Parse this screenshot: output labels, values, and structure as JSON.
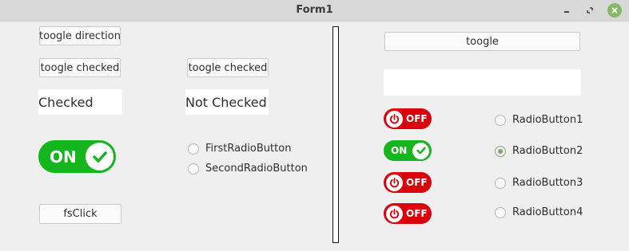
{
  "window": {
    "title": "Form1"
  },
  "left": {
    "toggle_direction_label": "toogle direction",
    "toggle_checked_label_1": "toogle checked",
    "toggle_checked_label_2": "toogle checked",
    "state_label_1": "Checked",
    "state_label_2": "Not Checked",
    "big_switch_text": "ON",
    "radios": [
      {
        "label": "FirstRadioButton",
        "checked": false
      },
      {
        "label": "SecondRadioButton",
        "checked": false
      }
    ],
    "fsclick_label": "fsClick"
  },
  "right": {
    "toggle_label": "toogle",
    "switches": [
      {
        "text": "OFF",
        "state": "off"
      },
      {
        "text": "ON",
        "state": "on"
      },
      {
        "text": "OFF",
        "state": "off"
      },
      {
        "text": "OFF",
        "state": "off"
      }
    ],
    "radios": [
      {
        "label": "RadioButton1",
        "checked": false
      },
      {
        "label": "RadioButton2",
        "checked": true
      },
      {
        "label": "RadioButton3",
        "checked": false
      },
      {
        "label": "RadioButton4",
        "checked": false
      }
    ]
  },
  "colors": {
    "on": "#14b51d",
    "off": "#d9020a",
    "radio_accent": "#7ea66a"
  }
}
